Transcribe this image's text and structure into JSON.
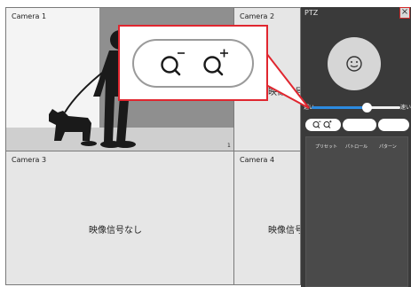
{
  "cameras": [
    {
      "label": "Camera 1",
      "channel_number": "1"
    },
    {
      "label": "Camera 2",
      "no_signal": "映像信号なし"
    },
    {
      "label": "Camera 3",
      "no_signal": "映像信号なし"
    },
    {
      "label": "Camera 4",
      "no_signal": "映像信号なし"
    }
  ],
  "ptz": {
    "title": "PTZ",
    "close_glyph": "×",
    "speed_slow": "遅い",
    "speed_fast": "速い",
    "speed_level": 0.62,
    "tabs": [
      "プリセット",
      "パトロール",
      "パターン"
    ]
  },
  "icons": {
    "zoom_out": "zoom-out-icon",
    "zoom_in": "zoom-in-icon",
    "ptz_center": "ptz-center-icon"
  },
  "colors": {
    "callout_border": "#e0262f",
    "slider_fill": "#2c8be0",
    "panel_bg": "#3a3a3a"
  }
}
